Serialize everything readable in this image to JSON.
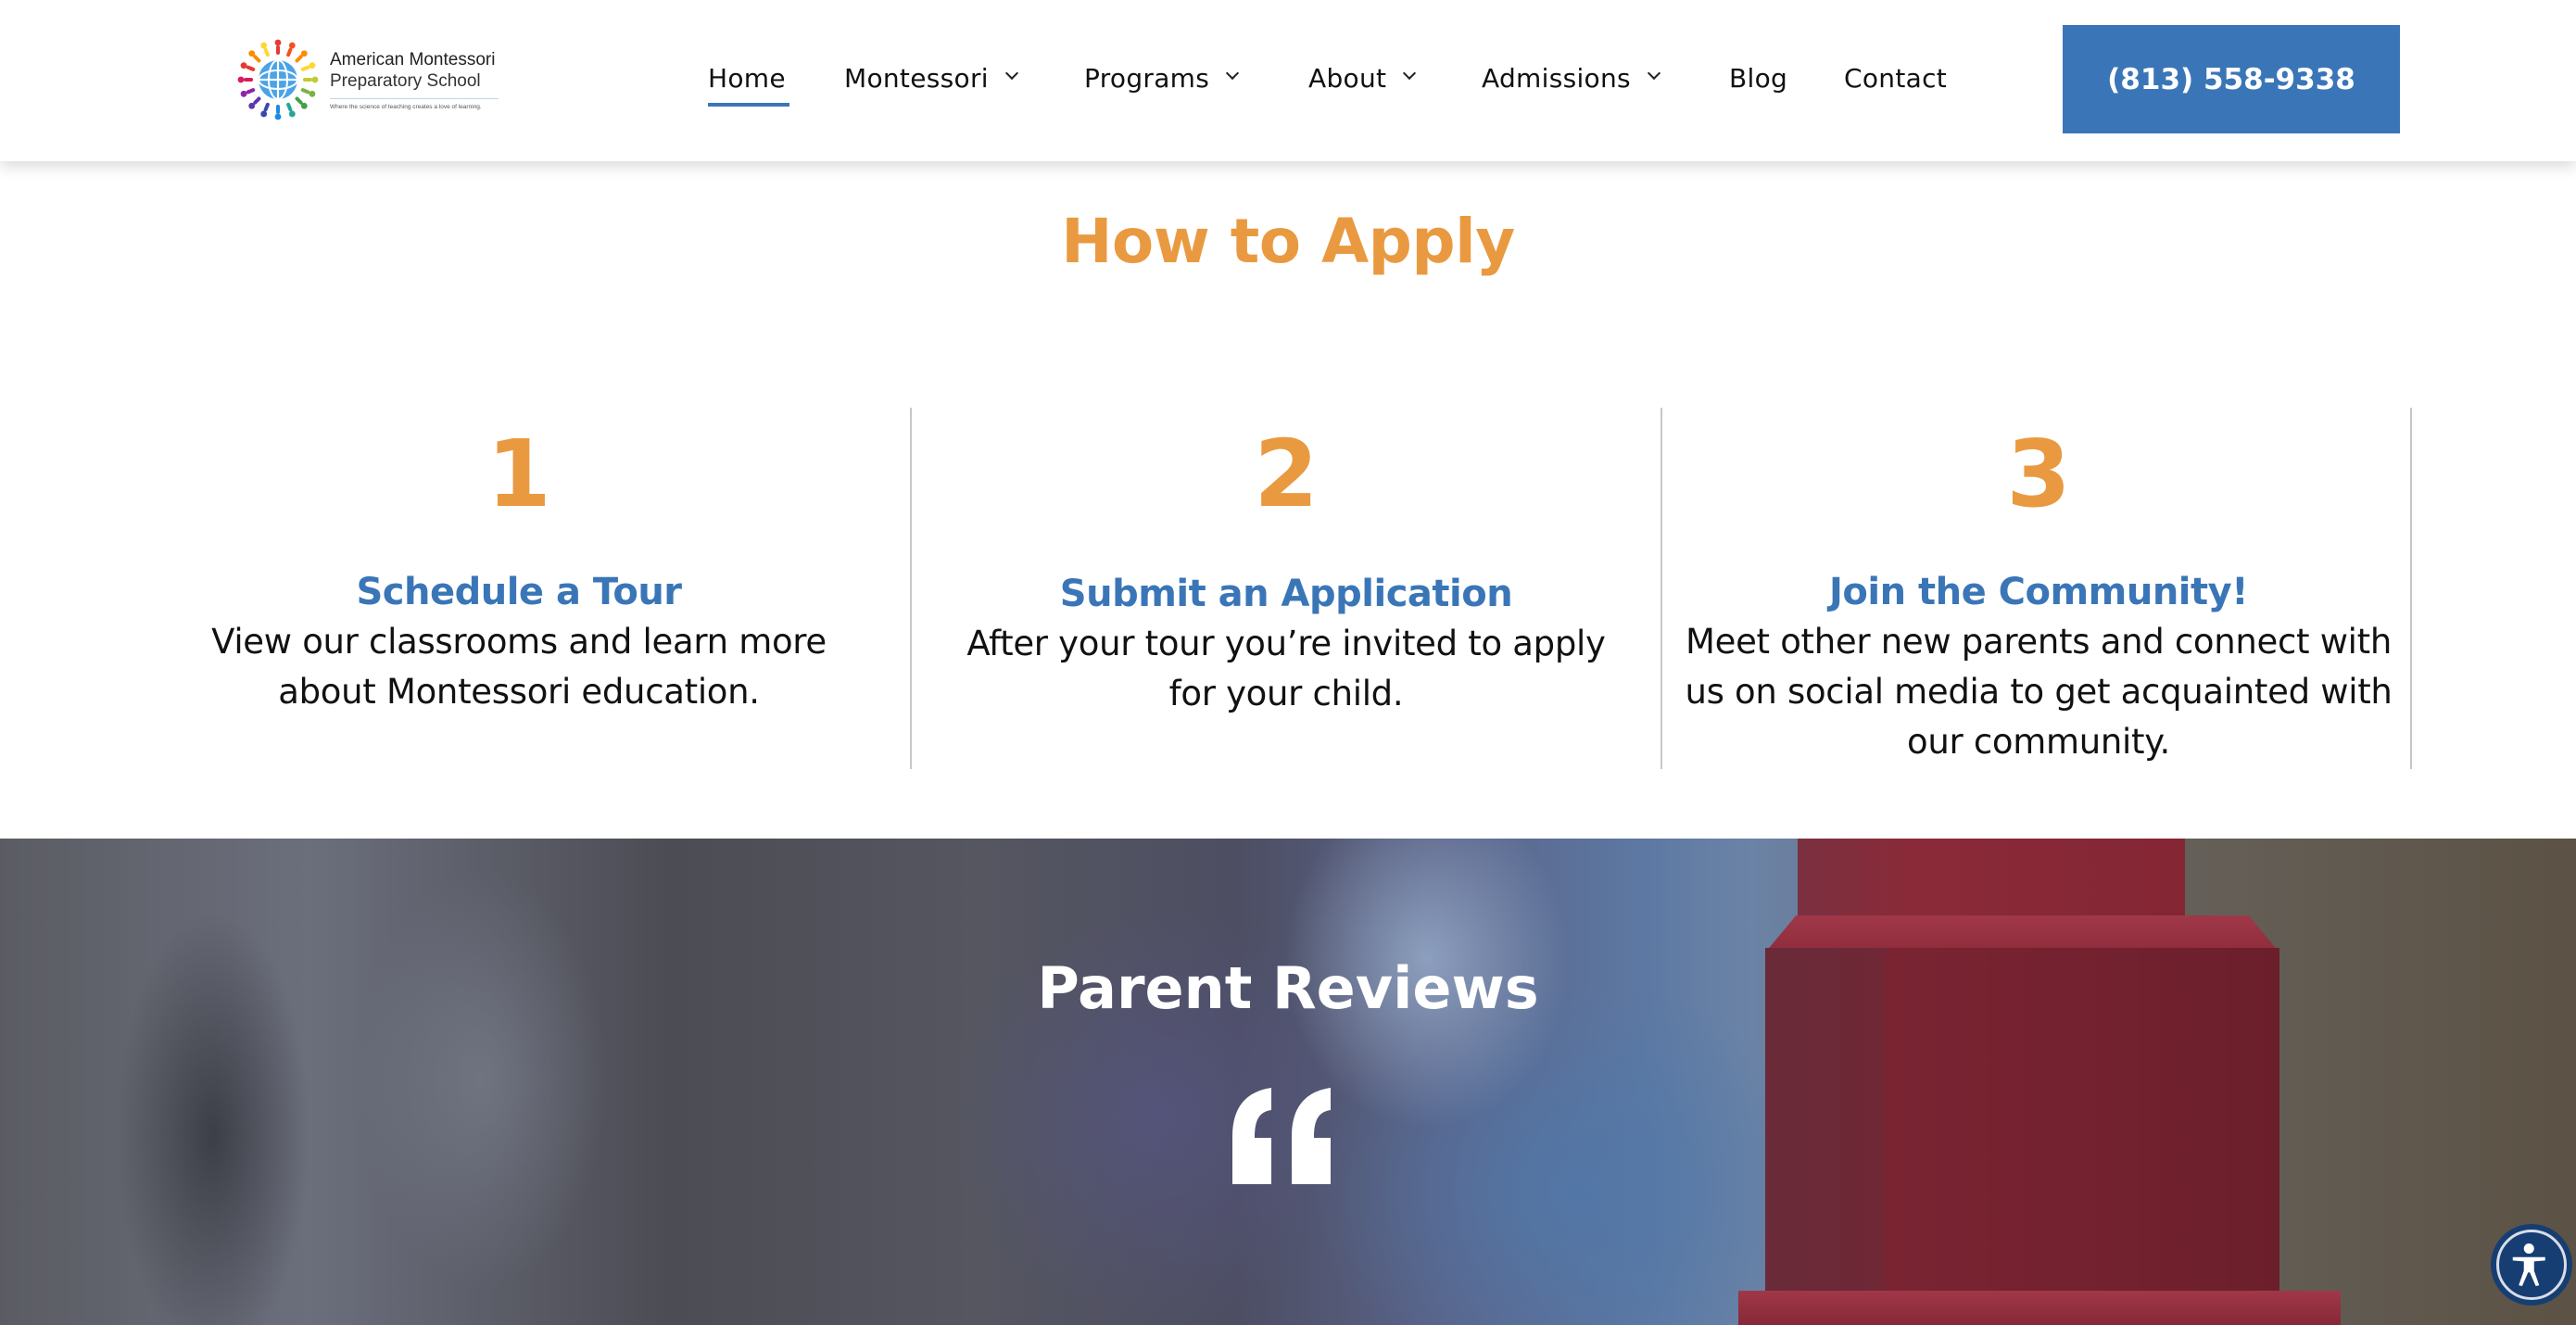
{
  "header": {
    "logo": {
      "name_line1": "American Montessori",
      "name_line2": "Preparatory School",
      "tagline": "Where the science of teaching creates a love of learning.",
      "icon": "globe-sunburst-logo-icon"
    },
    "nav": [
      {
        "label": "Home",
        "active": true,
        "has_dropdown": false
      },
      {
        "label": "Montessori",
        "active": false,
        "has_dropdown": true
      },
      {
        "label": "Programs",
        "active": false,
        "has_dropdown": true
      },
      {
        "label": "About",
        "active": false,
        "has_dropdown": true
      },
      {
        "label": "Admissions",
        "active": false,
        "has_dropdown": true
      },
      {
        "label": "Blog",
        "active": false,
        "has_dropdown": false
      },
      {
        "label": "Contact",
        "active": false,
        "has_dropdown": false
      }
    ],
    "phone_button": "(813) 558-9338"
  },
  "apply": {
    "title": "How to Apply",
    "steps": [
      {
        "number": "1",
        "heading": "Schedule a Tour",
        "body": "View our classrooms and learn more about Montessori education."
      },
      {
        "number": "2",
        "heading": "Submit an Application",
        "body": "After your tour you’re invited to apply for your child."
      },
      {
        "number": "3",
        "heading": "Join the Community!",
        "body": "Meet other new parents and connect with us on social media to get acquainted with our community."
      }
    ]
  },
  "reviews": {
    "title": "Parent Reviews",
    "quote_icon": "quote-icon"
  },
  "accessibility": {
    "icon": "accessibility-icon"
  },
  "colors": {
    "brand_blue": "#3a76b7",
    "accent_orange": "#e99a40",
    "text": "#111111",
    "divider": "#c7c7c7",
    "a11y_navy": "#163e72"
  }
}
